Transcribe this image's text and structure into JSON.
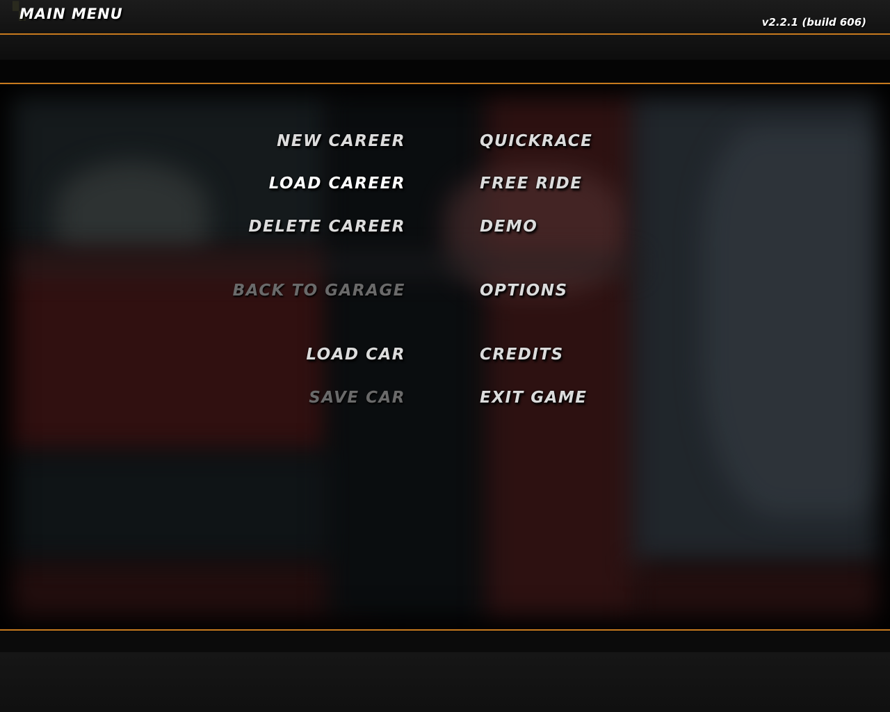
{
  "header": {
    "title": "MAIN MENU",
    "version": "v2.2.1 (build 606)"
  },
  "colors": {
    "accent_line": "#c87a1e",
    "menu_text": "#dcdcdc",
    "menu_text_highlight": "#ffffff",
    "menu_text_disabled": "#6a6a6a"
  },
  "menu": {
    "left": [
      {
        "label": "NEW CAREER",
        "state": "normal"
      },
      {
        "label": "LOAD CAREER",
        "state": "highlight"
      },
      {
        "label": "DELETE CAREER",
        "state": "normal"
      },
      {
        "label": "BACK TO GARAGE",
        "state": "disabled"
      },
      {
        "label": "LOAD CAR",
        "state": "normal"
      },
      {
        "label": "SAVE CAR",
        "state": "disabled"
      }
    ],
    "right": [
      {
        "label": "QUICKRACE",
        "state": "normal"
      },
      {
        "label": "FREE RIDE",
        "state": "normal"
      },
      {
        "label": "DEMO",
        "state": "normal"
      },
      {
        "label": "OPTIONS",
        "state": "normal"
      },
      {
        "label": "CREDITS",
        "state": "normal"
      },
      {
        "label": "EXIT GAME",
        "state": "normal"
      }
    ]
  }
}
